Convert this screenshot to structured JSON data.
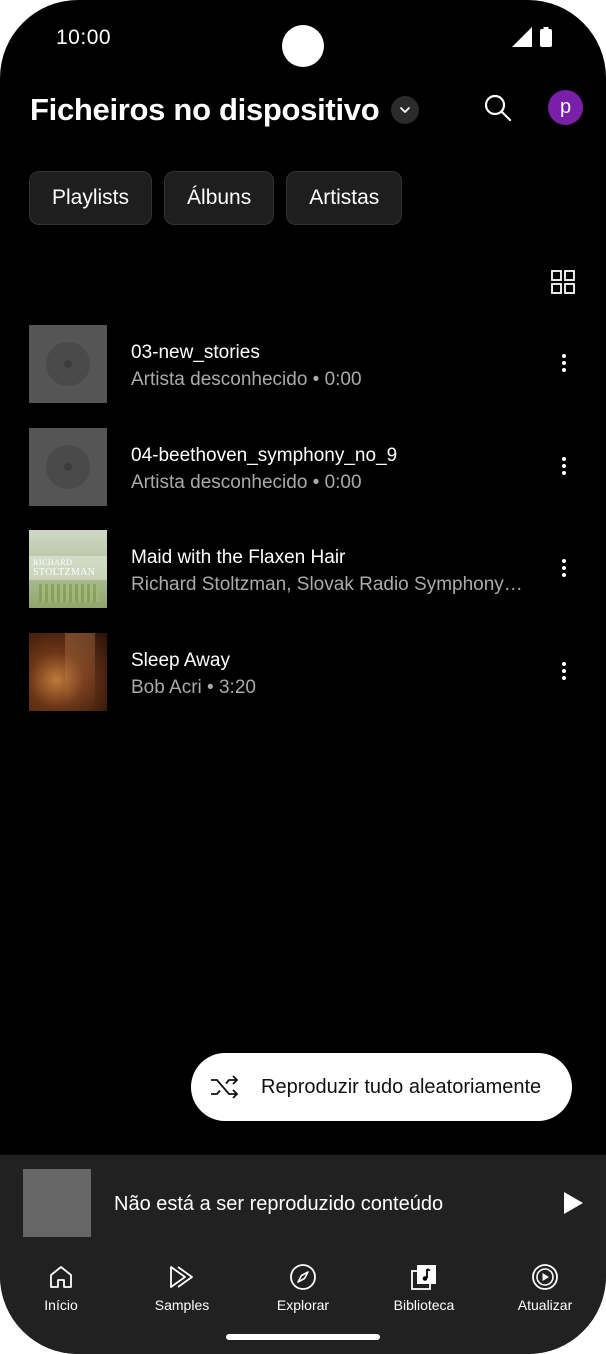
{
  "status_bar": {
    "time": "10:00"
  },
  "header": {
    "title": "Ficheiros no dispositivo",
    "avatar_letter": "p"
  },
  "chips": [
    "Playlists",
    "Álbuns",
    "Artistas"
  ],
  "tracks": [
    {
      "title": "03-new_stories",
      "subtitle": "Artista desconhecido • 0:00",
      "art": "disc-placeholder"
    },
    {
      "title": "04-beethoven_symphony_no_9",
      "subtitle": "Artista desconhecido • 0:00",
      "art": "disc-placeholder"
    },
    {
      "title": "Maid with the Flaxen Hair",
      "subtitle": "Richard Stoltzman, Slovak Radio Symphony Orchestra",
      "art": "album-cover",
      "cover_text": [
        "RICHARD",
        "STOLTZMAN"
      ]
    },
    {
      "title": "Sleep Away",
      "subtitle": "Bob Acri • 3:20",
      "art": "album-cover"
    }
  ],
  "shuffle_button": {
    "label": "Reproduzir tudo aleatoriamente"
  },
  "mini_player": {
    "text": "Não está a ser reproduzido conteúdo"
  },
  "nav": [
    {
      "label": "Início",
      "icon": "home-icon"
    },
    {
      "label": "Samples",
      "icon": "samples-icon"
    },
    {
      "label": "Explorar",
      "icon": "compass-icon"
    },
    {
      "label": "Biblioteca",
      "icon": "library-icon"
    },
    {
      "label": "Atualizar",
      "icon": "upgrade-icon"
    }
  ],
  "colors": {
    "background": "#000000",
    "surface": "#212121",
    "chip": "#1e1e1e",
    "avatar": "#7a1fa8",
    "secondary_text": "#aaaaaa"
  }
}
